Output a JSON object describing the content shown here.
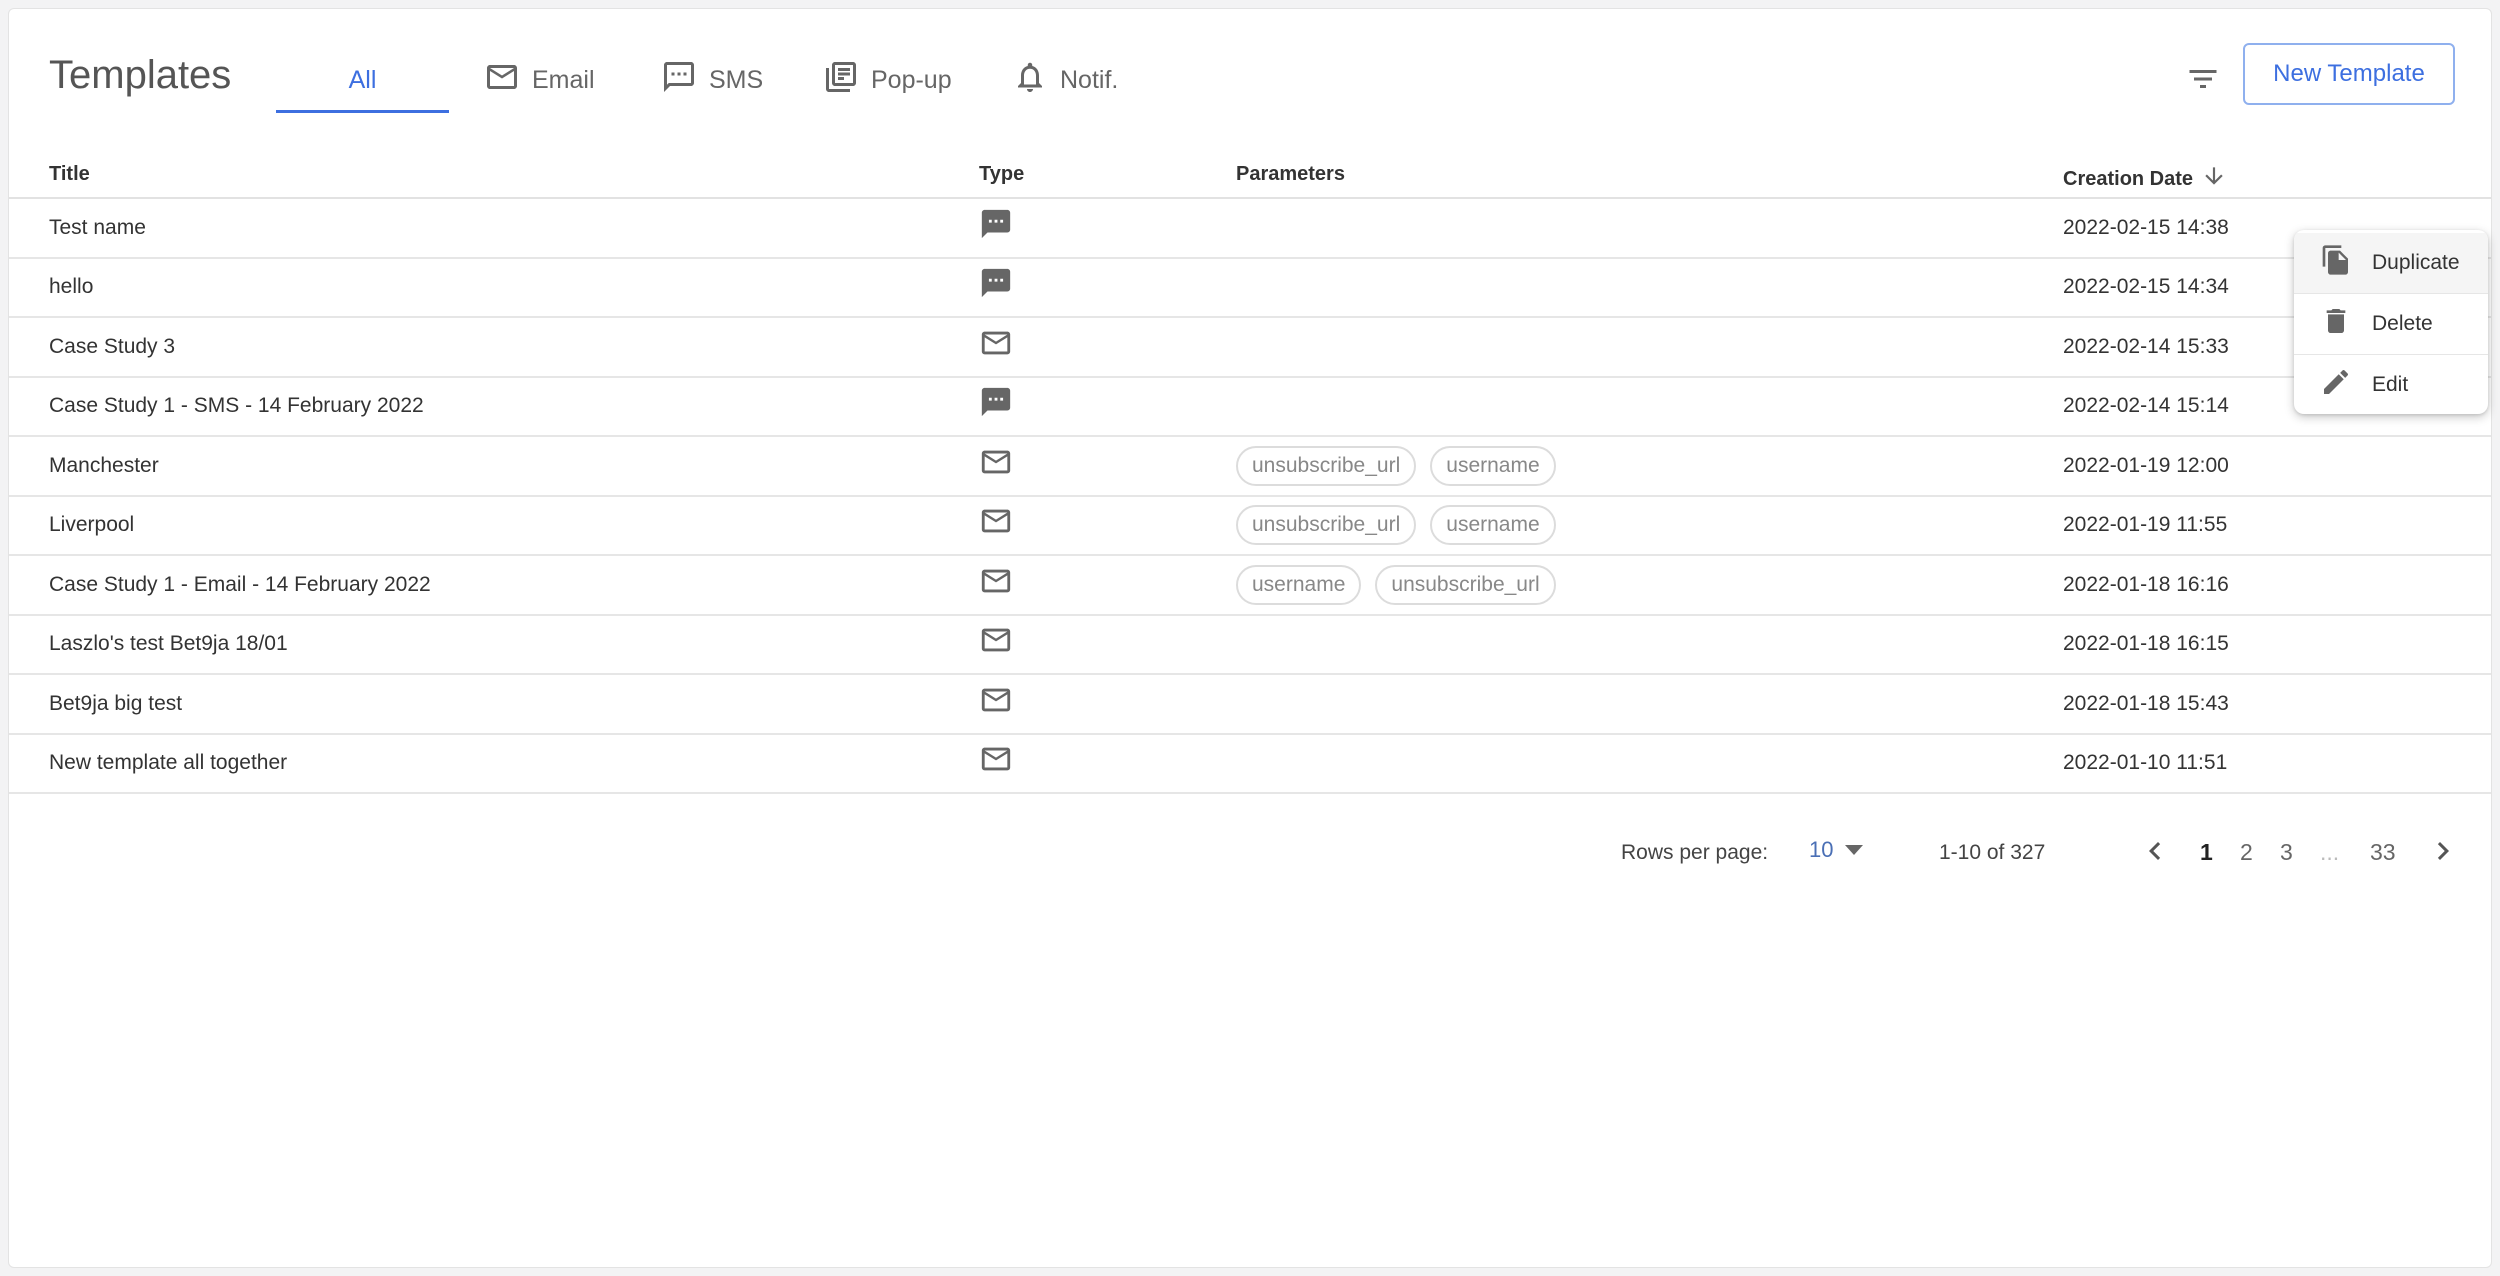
{
  "header": {
    "title": "Templates",
    "tabs": [
      {
        "label": "All",
        "icon": "none",
        "active": true
      },
      {
        "label": "Email",
        "icon": "mail-icon"
      },
      {
        "label": "SMS",
        "icon": "sms-icon"
      },
      {
        "label": "Pop-up",
        "icon": "popup-icon"
      },
      {
        "label": "Notif.",
        "icon": "bell-icon"
      }
    ],
    "new_button": "New Template"
  },
  "table": {
    "columns": {
      "title": "Title",
      "type": "Type",
      "parameters": "Parameters",
      "date": "Creation Date"
    },
    "sort": {
      "column": "Creation Date",
      "direction": "desc"
    },
    "rows": [
      {
        "title": "Test name",
        "type": "sms",
        "params": [],
        "date": "2022-02-15 14:38"
      },
      {
        "title": "hello",
        "type": "sms",
        "params": [],
        "date": "2022-02-15 14:34"
      },
      {
        "title": "Case Study 3",
        "type": "email",
        "params": [],
        "date": "2022-02-14 15:33"
      },
      {
        "title": "Case Study 1 - SMS - 14 February 2022",
        "type": "sms",
        "params": [],
        "date": "2022-02-14 15:14"
      },
      {
        "title": "Manchester",
        "type": "email",
        "params": [
          "unsubscribe_url",
          "username"
        ],
        "date": "2022-01-19 12:00"
      },
      {
        "title": "Liverpool",
        "type": "email",
        "params": [
          "unsubscribe_url",
          "username"
        ],
        "date": "2022-01-19 11:55"
      },
      {
        "title": "Case Study 1 - Email - 14 February 2022",
        "type": "email",
        "params": [
          "username",
          "unsubscribe_url"
        ],
        "date": "2022-01-18 16:16"
      },
      {
        "title": "Laszlo's test Bet9ja 18/01",
        "type": "email",
        "params": [],
        "date": "2022-01-18 16:15"
      },
      {
        "title": "Bet9ja big test",
        "type": "email",
        "params": [],
        "date": "2022-01-18 15:43"
      },
      {
        "title": "New template all together",
        "type": "email",
        "params": [],
        "date": "2022-01-10 11:51"
      }
    ]
  },
  "pagination": {
    "rows_per_page_label": "Rows per page:",
    "rows_per_page": "10",
    "range": "1-10 of 327",
    "pages": [
      "1",
      "2",
      "3"
    ],
    "ellipsis": "...",
    "last_page": "33",
    "current_page": "1"
  },
  "context_menu": {
    "items": [
      {
        "label": "Duplicate",
        "icon": "copy-icon"
      },
      {
        "label": "Delete",
        "icon": "trash-icon"
      },
      {
        "label": "Edit",
        "icon": "pencil-icon"
      }
    ]
  },
  "colors": {
    "accent": "#3d6fe0",
    "icon": "#666666",
    "border": "#e6e6e6"
  }
}
